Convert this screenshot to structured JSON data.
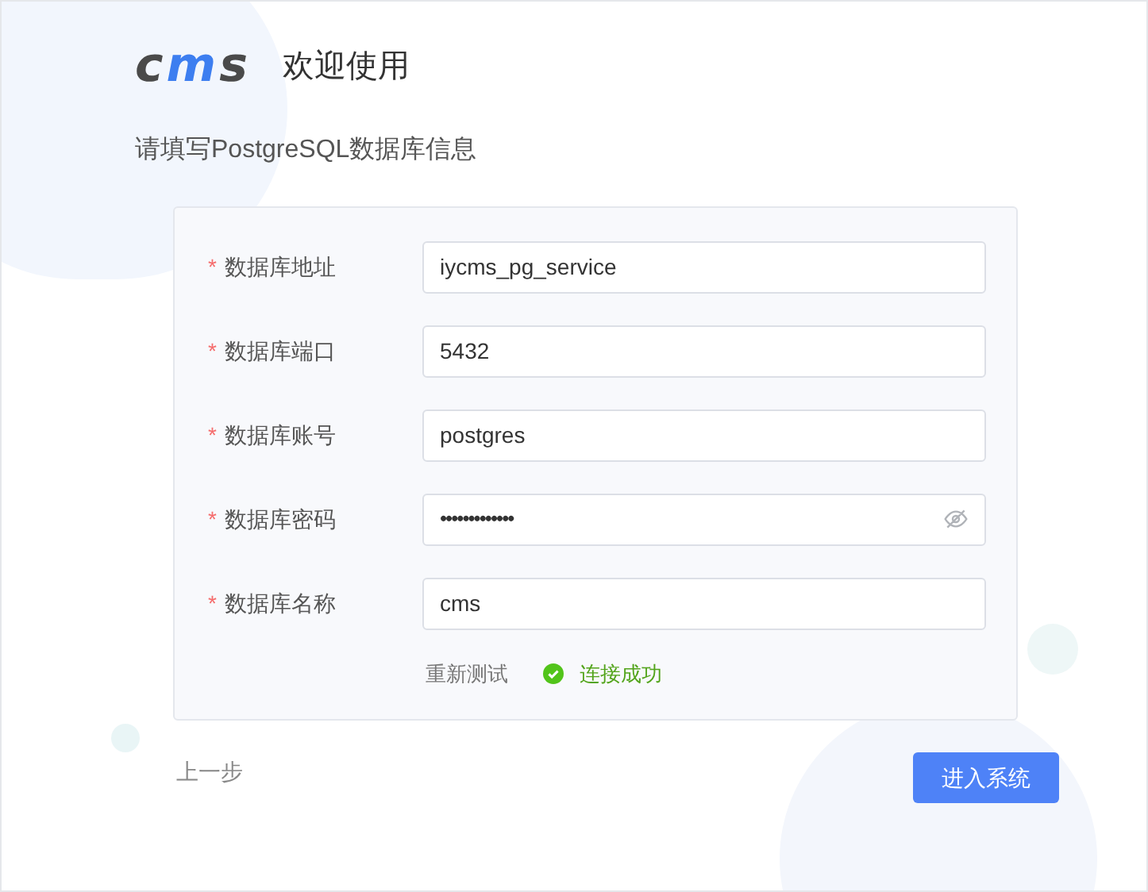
{
  "header": {
    "logo": "cms",
    "title": "欢迎使用"
  },
  "subtitle": "请填写PostgreSQL数据库信息",
  "form": {
    "fields": [
      {
        "mark": "*",
        "label": "数据库地址",
        "kind": "text",
        "value": "iycms_pg_service"
      },
      {
        "mark": "*",
        "label": "数据库端口",
        "kind": "text",
        "value": "5432"
      },
      {
        "mark": "*",
        "label": "数据库账号",
        "kind": "text",
        "value": "postgres"
      },
      {
        "mark": "*",
        "label": "数据库密码",
        "kind": "password",
        "value": "•••••••••••••"
      },
      {
        "mark": "*",
        "label": "数据库名称",
        "kind": "text",
        "value": "cms"
      }
    ],
    "retest": "重新测试",
    "status": {
      "text": "连接成功",
      "success": true
    }
  },
  "back": "上一步",
  "submit": "进入系统"
}
